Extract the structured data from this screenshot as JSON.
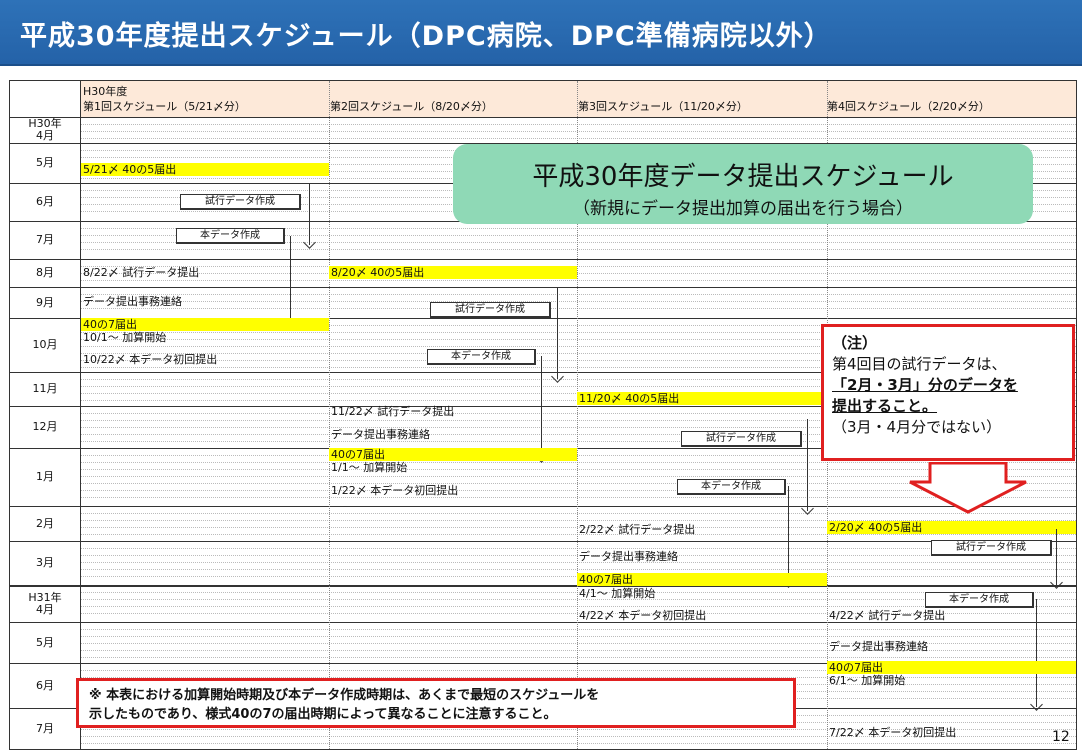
{
  "title": "平成30年度提出スケジュール（DPC病院、DPC準備病院以外）",
  "table": {
    "year_label": "H30年度",
    "columns": [
      "第1回スケジュール（5/21〆分）",
      "第2回スケジュール（8/20〆分）",
      "第3回スケジュール（11/20〆分）",
      "第4回スケジュール（2/20〆分）"
    ],
    "months": [
      "H30年\n4月",
      "5月",
      "6月",
      "7月",
      "8月",
      "9月",
      "10月",
      "11月",
      "12月",
      "1月",
      "2月",
      "3月",
      "H31年\n4月",
      "5月",
      "6月",
      "7月"
    ]
  },
  "events": {
    "c1_r5": "5/21〆 40の5届出",
    "c1_r8": "8/22〆 試行データ提出",
    "c1_r9": "データ提出事務連絡",
    "c1_r9b": "40の7届出",
    "c1_r10a": "10/1～ 加算開始",
    "c1_r10b": "10/22〆 本データ初回提出",
    "c2_r8": "8/20〆 40の5届出",
    "c2_r11": "11/22〆 試行データ提出",
    "c2_r12a": "データ提出事務連絡",
    "c2_r12b": "40の7届出",
    "c2_r1a": "1/1～ 加算開始",
    "c2_r1b": "1/22〆 本データ初回提出",
    "c3_r11": "11/20〆 40の5届出",
    "c3_r2": "2/22〆 試行データ提出",
    "c3_r3a": "データ提出事務連絡",
    "c3_r3b": "40の7届出",
    "c3_r4a": "4/1～ 加算開始",
    "c3_r4b": "4/22〆 本データ初回提出",
    "c4_r2": "2/20〆 40の5届出",
    "c4_r4": "4/22〆 試行データ提出",
    "c4_r5a": "データ提出事務連絡",
    "c4_r5b": "40の7届出",
    "c4_r6": "6/1～ 加算開始",
    "c4_r7": "7/22〆 本データ初回提出"
  },
  "boxes": {
    "trial": "試行データ作成",
    "main": "本データ作成"
  },
  "callout": {
    "title": "平成30年度データ提出スケジュール",
    "subtitle": "（新規にデータ提出加算の届出を行う場合）"
  },
  "note": {
    "head": "（注）",
    "line1": "第4回目の試行データは、",
    "line2": "「2月・3月」分のデータを",
    "line3": "提出すること。",
    "line4": "（3月・4月分ではない）"
  },
  "footnote": {
    "line1": "※ 本表における加算開始時期及び本データ作成時期は、あくまで最短のスケジュールを",
    "line2": "示したものであり、様式40の7の届出時期によって異なることに注意すること。"
  },
  "page_number": "12",
  "colors": {
    "header": "#2462a8",
    "highlight": "#ffff00",
    "callout": "#8fd9b6",
    "note_border": "#e02020"
  }
}
